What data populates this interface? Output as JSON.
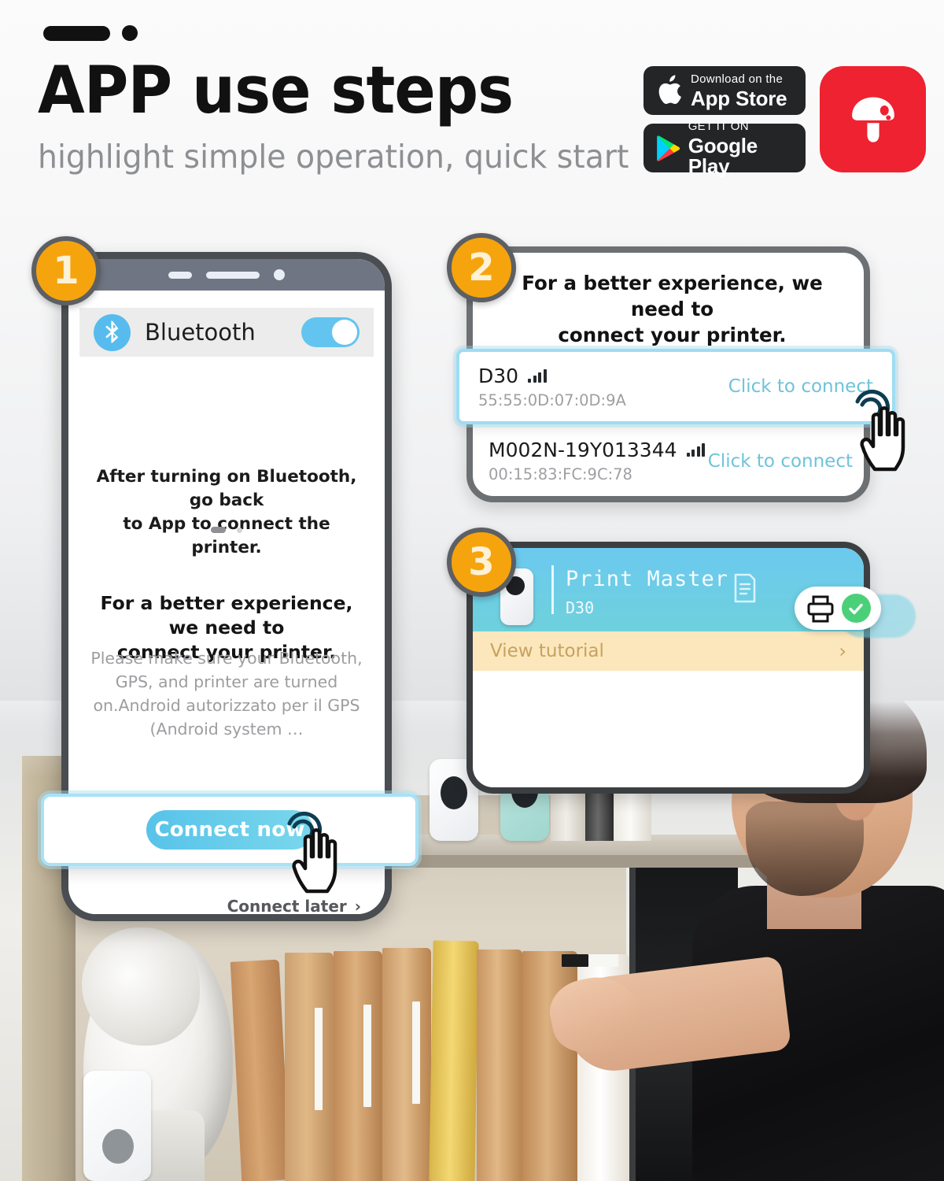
{
  "header": {
    "title_bold": "APP",
    "title_rest": " use steps",
    "subtitle": "highlight simple operation, quick start",
    "app_store": {
      "small": "Download on the",
      "large": "App Store",
      "icon": "apple-icon"
    },
    "google_play": {
      "small": "GET IT ON",
      "large": "Google Play",
      "icon": "google-play-icon"
    },
    "app_icon": {
      "name": "mushroom-app-icon",
      "color": "#ee2230"
    }
  },
  "steps": [
    {
      "number": "1",
      "bluetooth_row": {
        "label": "Bluetooth",
        "icon": "bluetooth-icon",
        "toggle_state": "on"
      },
      "instruction": "After turning on Bluetooth, go back\nto App to connect the printer.",
      "headline": "For a better experience, we need to\nconnect your printer.",
      "body": "Please make sure your Bluetooth, GPS, and printer are turned on.Android autorizzato per il GPS (Android system …",
      "connect_now": "Connect now",
      "connect_later": "Connect later",
      "chevron": "›"
    },
    {
      "number": "2",
      "title": "For a better experience, we need to\nconnect your printer.",
      "devices": [
        {
          "name": "D30",
          "mac": "55:55:0D:07:0D:9A",
          "cta": "Click to connect",
          "signal": "signal-bars-icon",
          "highlighted": true
        },
        {
          "name": "M002N-19Y013344",
          "mac": "00:15:83:FC:9C:78",
          "cta": "Click to connect",
          "signal": "signal-bars-icon",
          "highlighted": false
        }
      ]
    },
    {
      "number": "3",
      "printer": {
        "name": "Print Master",
        "model": "D30",
        "doc_icon": "document-icon",
        "printer_icon": "printer-icon",
        "status_icon": "check-circle-icon",
        "status_color": "#4bd07a"
      },
      "tutorial": {
        "label": "View tutorial",
        "chevron": "›"
      }
    }
  ],
  "colors": {
    "accent_orange": "#f6a40d",
    "accent_blue": "#57c3e9",
    "highlight_border": "#9fdcf3",
    "brand_red": "#ee2230",
    "badge_ring": "#5c5f63"
  }
}
